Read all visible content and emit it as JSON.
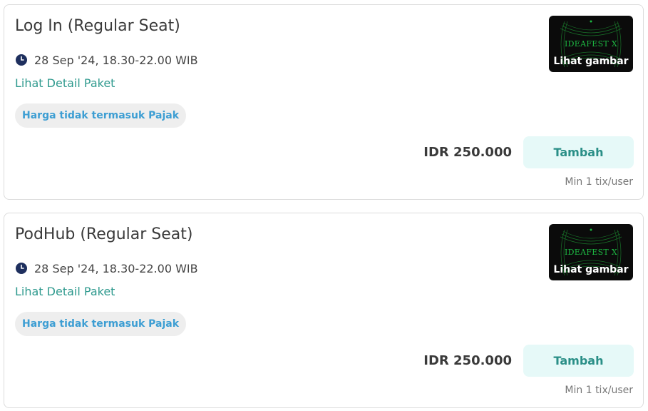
{
  "tickets": [
    {
      "title": "Log In (Regular Seat)",
      "schedule": "28 Sep '24, 18.30-22.00 WIB",
      "detail_link": "Lihat Detail Paket",
      "tax_note": "Harga tidak termasuk Pajak",
      "image_brand": "IDEAFEST X",
      "image_caption": "Lihat gambar",
      "price": "IDR 250.000",
      "add_label": "Tambah",
      "min_note": "Min 1 tix/user"
    },
    {
      "title": "PodHub (Regular Seat)",
      "schedule": "28 Sep '24, 18.30-22.00 WIB",
      "detail_link": "Lihat Detail Paket",
      "tax_note": "Harga tidak termasuk Pajak",
      "image_brand": "IDEAFEST X",
      "image_caption": "Lihat gambar",
      "price": "IDR 250.000",
      "add_label": "Tambah",
      "min_note": "Min 1 tix/user"
    }
  ],
  "icons": {
    "schedule": "clock-icon"
  },
  "colors": {
    "accent": "#2f9a8e",
    "button_bg": "#e6f9f8",
    "badge_text": "#3d9ed3",
    "clock": "#1e2f5e"
  }
}
